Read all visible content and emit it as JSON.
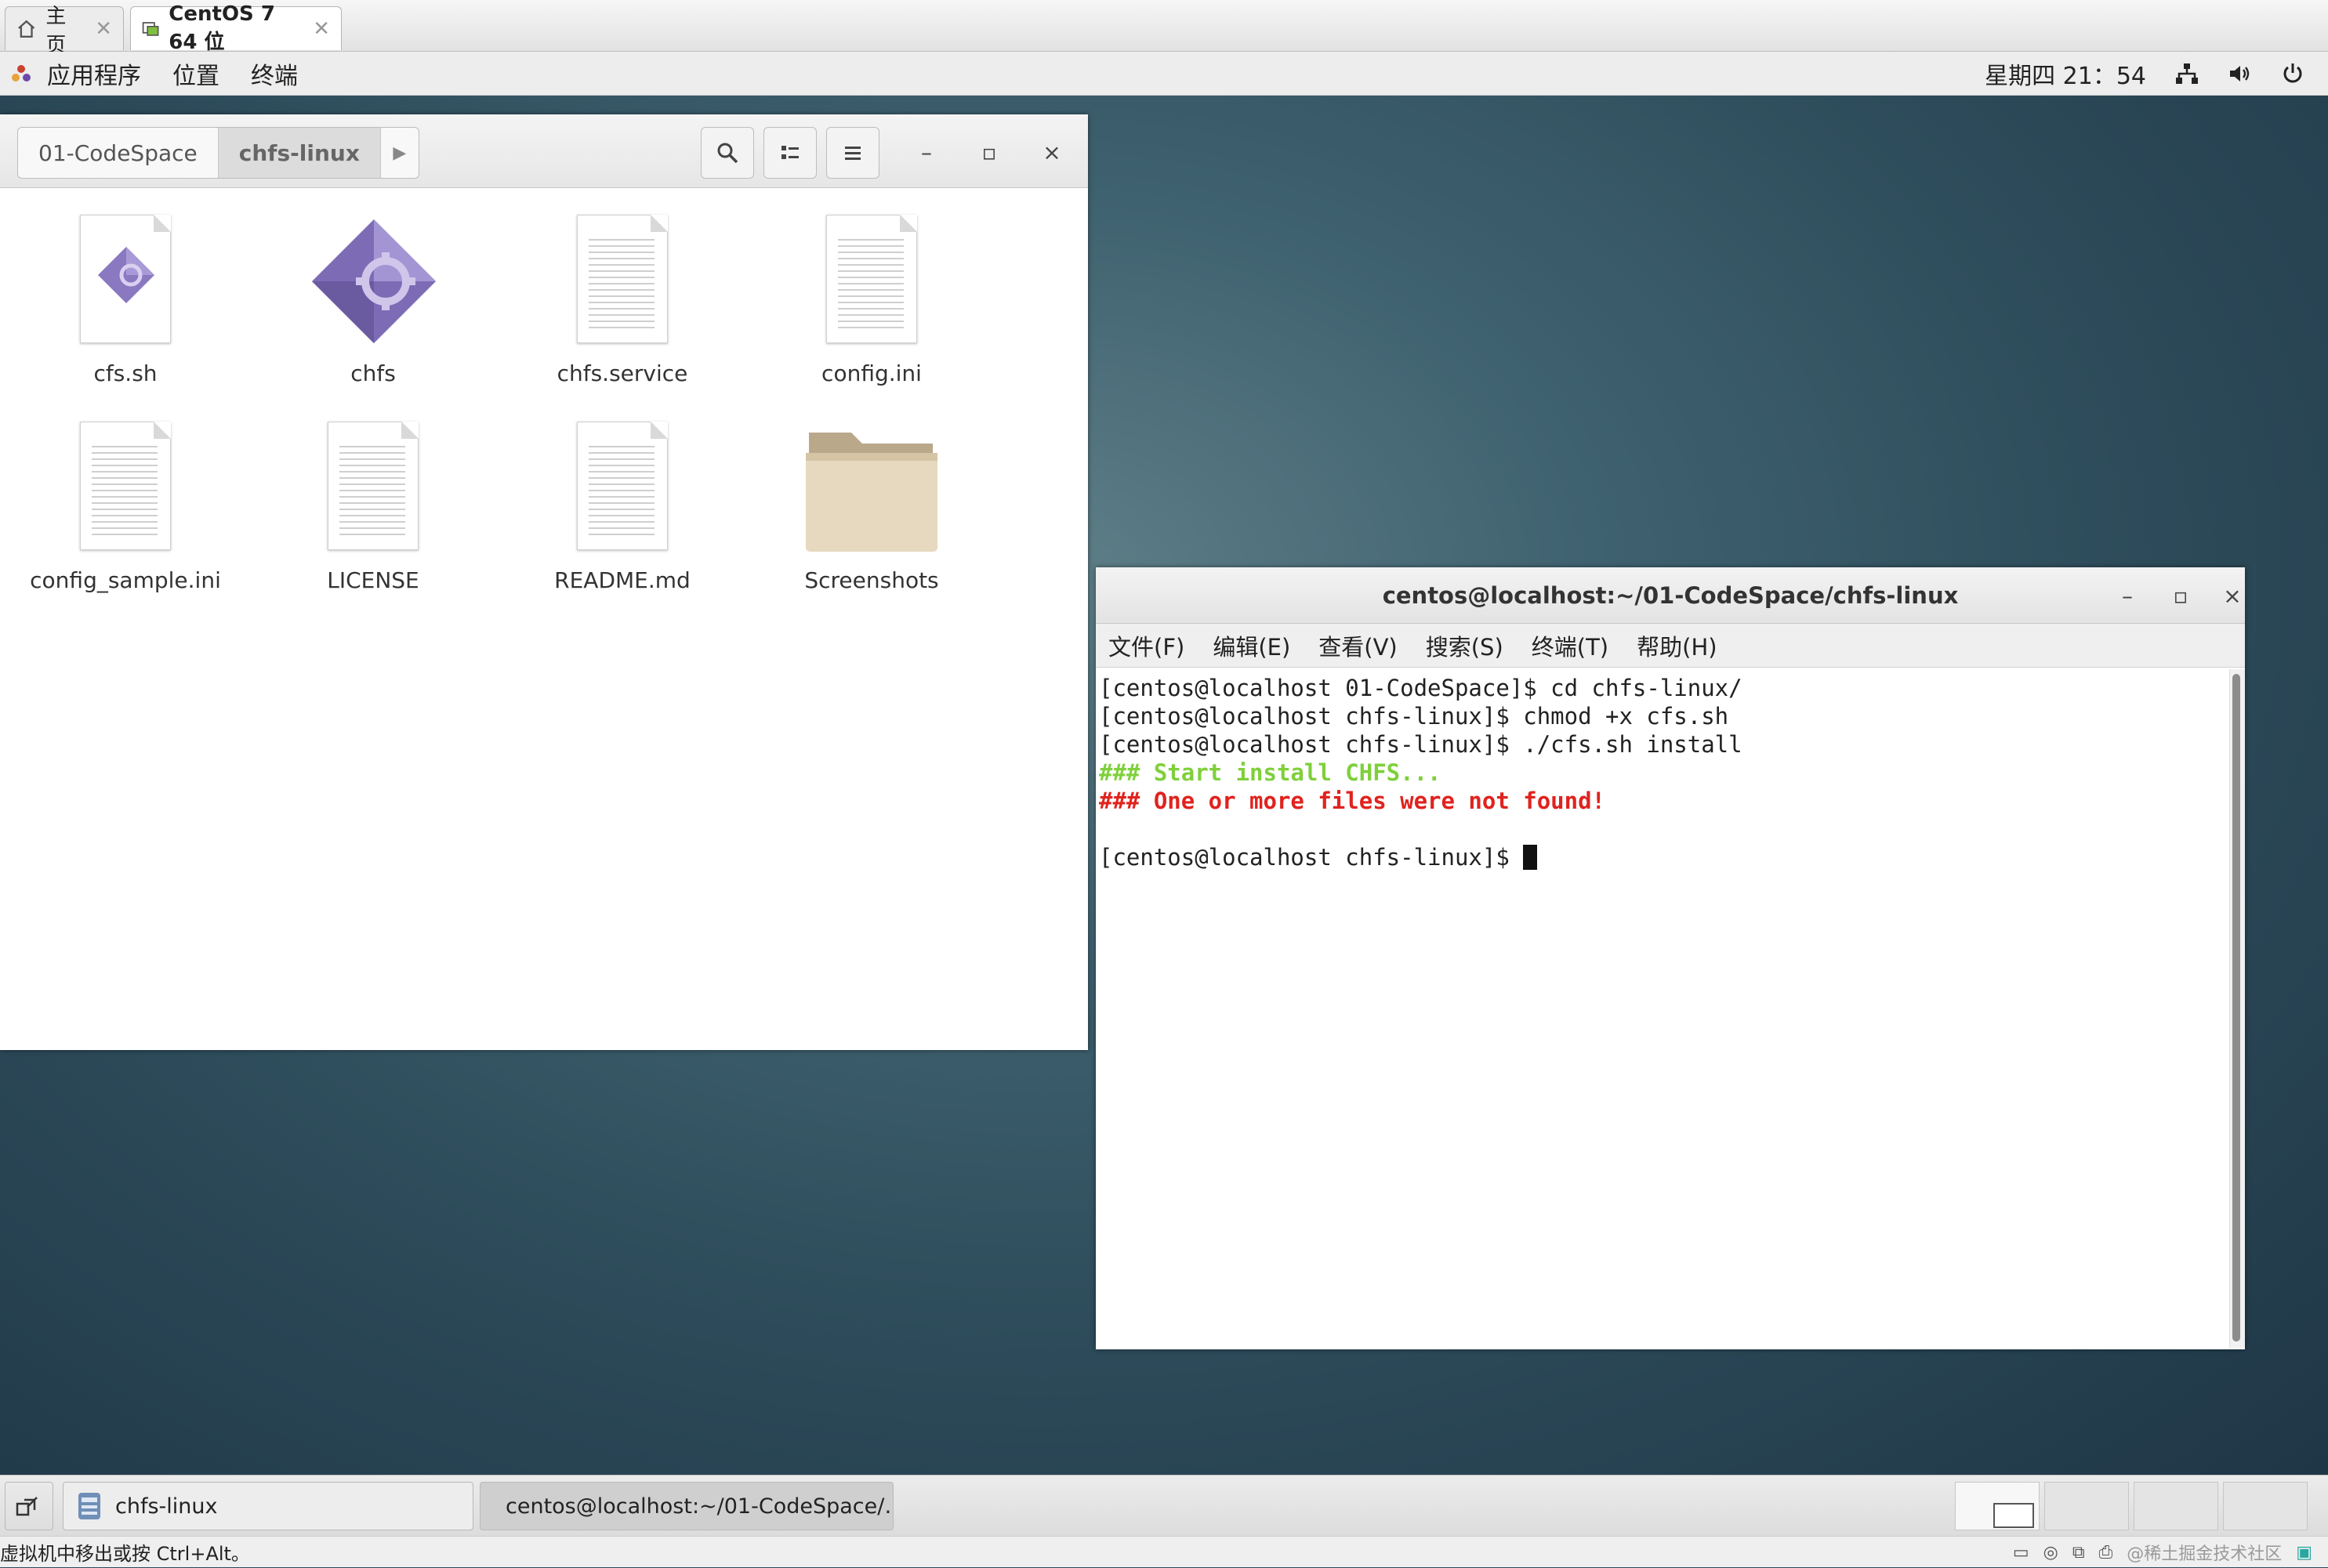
{
  "vm_tabs": [
    {
      "label": "主页",
      "icon": "home-icon"
    },
    {
      "label": "CentOS 7 64 位",
      "icon": "vm-icon"
    }
  ],
  "topbar": {
    "menus": [
      "应用程序",
      "位置",
      "终端"
    ],
    "clock": "星期四 21：54",
    "icons": [
      "network-icon",
      "volume-icon",
      "power-icon"
    ]
  },
  "files": {
    "breadcrumbs": [
      "01-CodeSpace",
      "chfs-linux"
    ],
    "items": [
      {
        "name": "cfs.sh",
        "type": "script"
      },
      {
        "name": "chfs",
        "type": "executable"
      },
      {
        "name": "chfs.service",
        "type": "text"
      },
      {
        "name": "config.ini",
        "type": "text"
      },
      {
        "name": "config_sample.ini",
        "type": "text"
      },
      {
        "name": "LICENSE",
        "type": "text"
      },
      {
        "name": "README.md",
        "type": "text"
      },
      {
        "name": "Screenshots",
        "type": "folder"
      }
    ],
    "controls": {
      "minimize": "–",
      "maximize": "▫",
      "close": "×"
    }
  },
  "terminal": {
    "title": "centos@localhost:~/01-CodeSpace/chfs-linux",
    "menu": [
      "文件(F)",
      "编辑(E)",
      "查看(V)",
      "搜索(S)",
      "终端(T)",
      "帮助(H)"
    ],
    "lines": [
      "[centos@localhost 01-CodeSpace]$ cd chfs-linux/",
      "[centos@localhost chfs-linux]$ chmod +x cfs.sh",
      "[centos@localhost chfs-linux]$ ./cfs.sh install"
    ],
    "msg_green": "### Start install CHFS...",
    "msg_red": "### One or more files were not found!",
    "prompt": "[centos@localhost chfs-linux]$ ",
    "colors": {
      "green": "#7fd03b",
      "red": "#e0231e"
    }
  },
  "taskbar": {
    "items": [
      "chfs-linux",
      "centos@localhost:~/01-CodeSpace/…"
    ]
  },
  "statusbar": {
    "hint": "虚拟机中移出或按 Ctrl+Alt。",
    "watermark": "@稀土掘金技术社区"
  }
}
